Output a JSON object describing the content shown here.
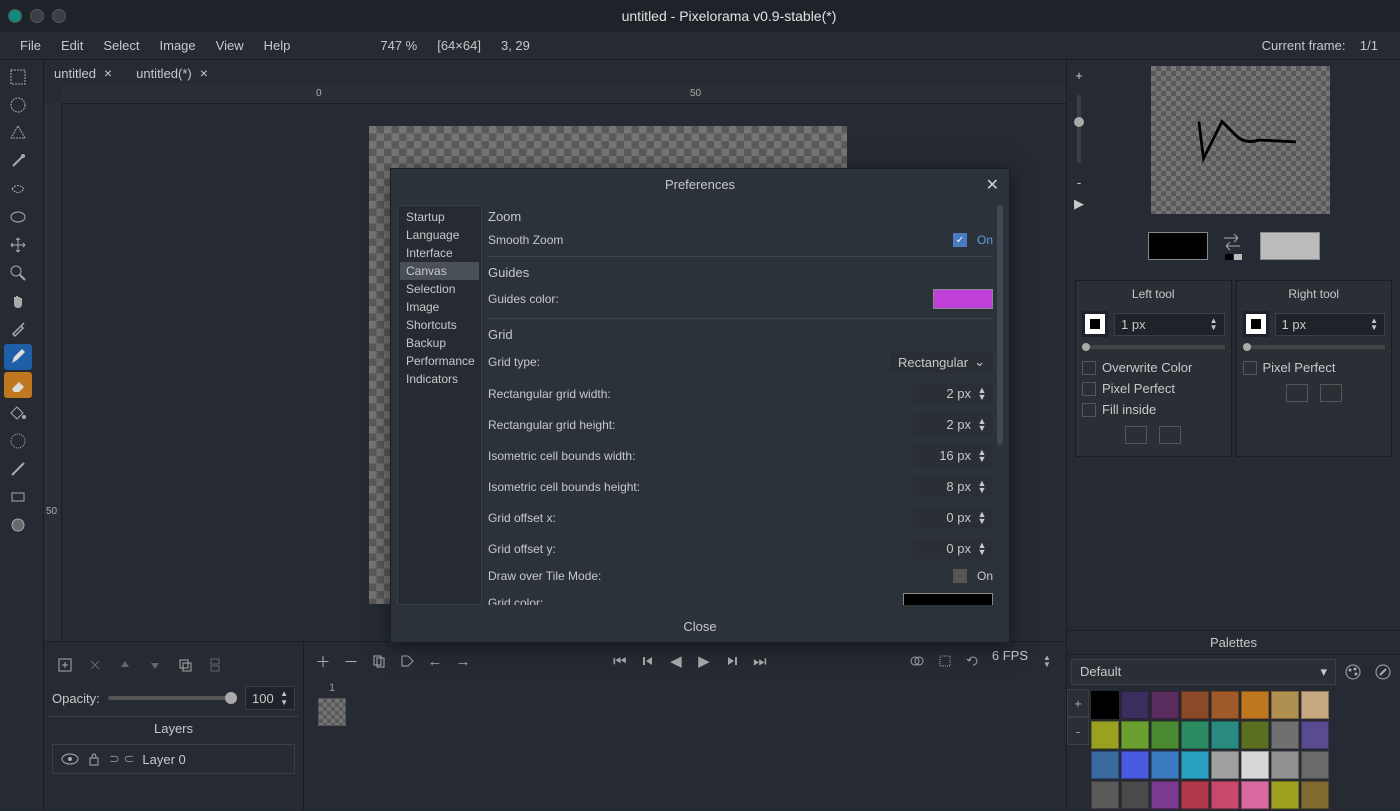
{
  "title": "untitled - Pixelorama v0.9-stable(*)",
  "menu": {
    "file": "File",
    "edit": "Edit",
    "select": "Select",
    "image": "Image",
    "view": "View",
    "help": "Help"
  },
  "zoom": "747 %",
  "dims": "[64×64]",
  "coords": "3, 29",
  "frame_label": "Current frame:",
  "frame_value": "1/1",
  "tabs": [
    {
      "name": "untitled",
      "active": false
    },
    {
      "name": "untitled(*)",
      "active": true
    }
  ],
  "ruler": {
    "zero": "0",
    "fifty": "50",
    "fifty_v": "50"
  },
  "bottom": {
    "opacity_label": "Opacity:",
    "opacity_value": "100",
    "layers_label": "Layers",
    "layer0": "Layer 0",
    "frame1": "1",
    "fps": "6 FPS"
  },
  "right": {
    "left_tool": "Left tool",
    "right_tool": "Right tool",
    "px1": "1 px",
    "overwrite": "Overwrite Color",
    "pixel_perfect": "Pixel Perfect",
    "fill_inside": "Fill inside",
    "palettes": "Palettes",
    "palette_name": "Default",
    "plus": "+",
    "minus": "-"
  },
  "palette_colors": [
    "#000000",
    "#3b2d5e",
    "#5a2d5e",
    "#8a4a2a",
    "#a05a2a",
    "#c07820",
    "#b09050",
    "#c8a880",
    "#9aa020",
    "#6aa030",
    "#4a8a30",
    "#2a8a60",
    "#2a8a80",
    "#5a7020",
    "#707070",
    "#5a4a90",
    "#3a6aa0",
    "#4a5ae0",
    "#3a7ac0",
    "#2aa0c0",
    "#a0a0a0",
    "#d8d8d8",
    "#909090",
    "#6a6a6a",
    "#5a5a5a",
    "#4a4a4a",
    "#7a3a90",
    "#b03a4a",
    "#c84a6a",
    "#d86aa0",
    "#a0a020",
    "#806a30"
  ],
  "dialog": {
    "title": "Preferences",
    "side": {
      "startup": "Startup",
      "language": "Language",
      "interface": "Interface",
      "canvas": "Canvas",
      "selection": "Selection",
      "image": "Image",
      "shortcuts": "Shortcuts",
      "backup": "Backup",
      "performance": "Performance",
      "indicators": "Indicators"
    },
    "zoom": "Zoom",
    "smooth_zoom": "Smooth Zoom",
    "on": "On",
    "guides": "Guides",
    "guides_color": "Guides color:",
    "grid": "Grid",
    "grid_type": "Grid type:",
    "grid_type_val": "Rectangular",
    "rect_w": "Rectangular grid width:",
    "rect_w_v": "2 px",
    "rect_h": "Rectangular grid height:",
    "rect_h_v": "2 px",
    "iso_w": "Isometric cell bounds width:",
    "iso_w_v": "16 px",
    "iso_h": "Isometric cell bounds height:",
    "iso_h_v": "8 px",
    "off_x": "Grid offset x:",
    "off_x_v": "0 px",
    "off_y": "Grid offset y:",
    "off_y_v": "0 px",
    "draw_tile": "Draw over Tile Mode:",
    "grid_color": "Grid color:",
    "close": "Close"
  }
}
